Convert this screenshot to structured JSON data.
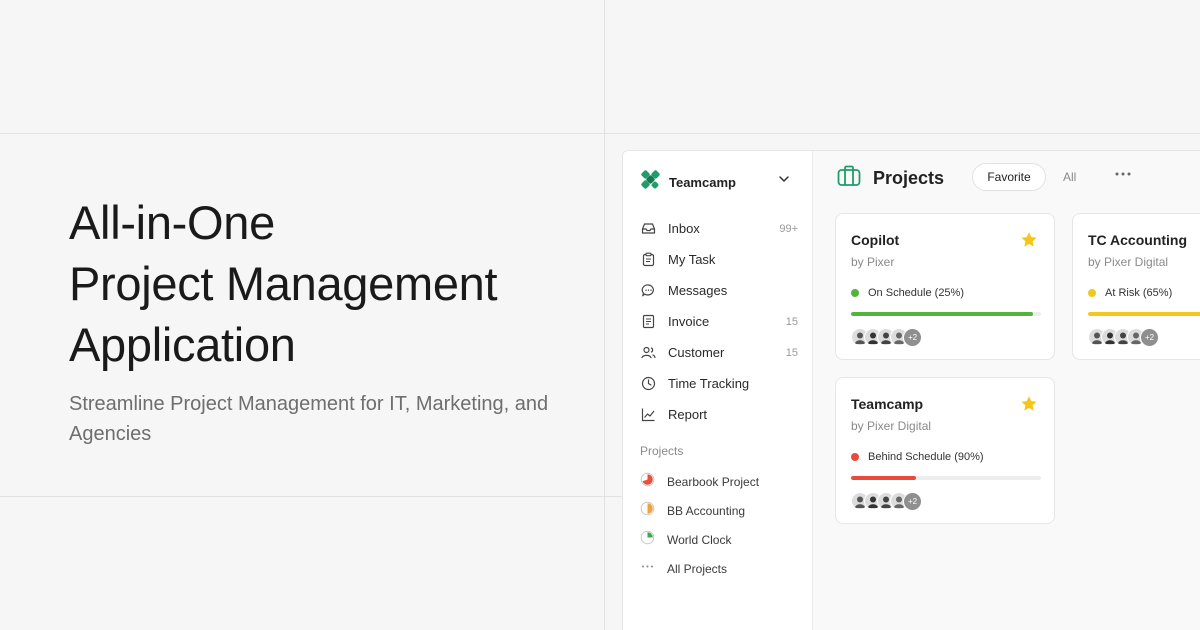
{
  "hero": {
    "title_lines": [
      "All-in-One",
      "Project Management",
      "Application"
    ],
    "subtitle": "Streamline Project Management for IT, Marketing, and Agencies"
  },
  "sidebar": {
    "brand": "Teamcamp",
    "nav": [
      {
        "label": "Inbox",
        "count": "99+",
        "icon": "inbox-icon"
      },
      {
        "label": "My Task",
        "count": "",
        "icon": "clipboard-icon"
      },
      {
        "label": "Messages",
        "count": "",
        "icon": "chat-icon"
      },
      {
        "label": "Invoice",
        "count": "15",
        "icon": "document-icon"
      },
      {
        "label": "Customer",
        "count": "15",
        "icon": "users-icon"
      },
      {
        "label": "Time Tracking",
        "count": "",
        "icon": "clock-icon"
      },
      {
        "label": "Report",
        "count": "",
        "icon": "chart-icon"
      }
    ],
    "projects_label": "Projects",
    "projects": [
      {
        "label": "Bearbook Project",
        "color": "#e8513f"
      },
      {
        "label": "BB Accounting",
        "color": "#f0a33b"
      },
      {
        "label": "World Clock",
        "color": "#3fa84a"
      },
      {
        "label": "All Projects",
        "color": ""
      }
    ]
  },
  "main": {
    "title": "Projects",
    "tab_favorite": "Favorite",
    "tab_all": "All",
    "cards": [
      {
        "title": "Copilot",
        "by": "by Pixer",
        "status": "On Schedule (25%)",
        "color": "#52b43a",
        "progress": 0.96,
        "extra": "+2"
      },
      {
        "title": "TC Accounting",
        "by": "by Pixer Digital",
        "status": "At Risk (65%)",
        "color": "#f2c81c",
        "progress": 0.65,
        "extra": "+2"
      },
      {
        "title": "Teamcamp",
        "by": "by Pixer Digital",
        "status": "Behind Schedule (90%)",
        "color": "#ea4a3c",
        "progress": 0.34,
        "extra": "+2"
      }
    ]
  },
  "colors": {
    "brand": "#1f9d6b",
    "star": "#f5c518"
  }
}
